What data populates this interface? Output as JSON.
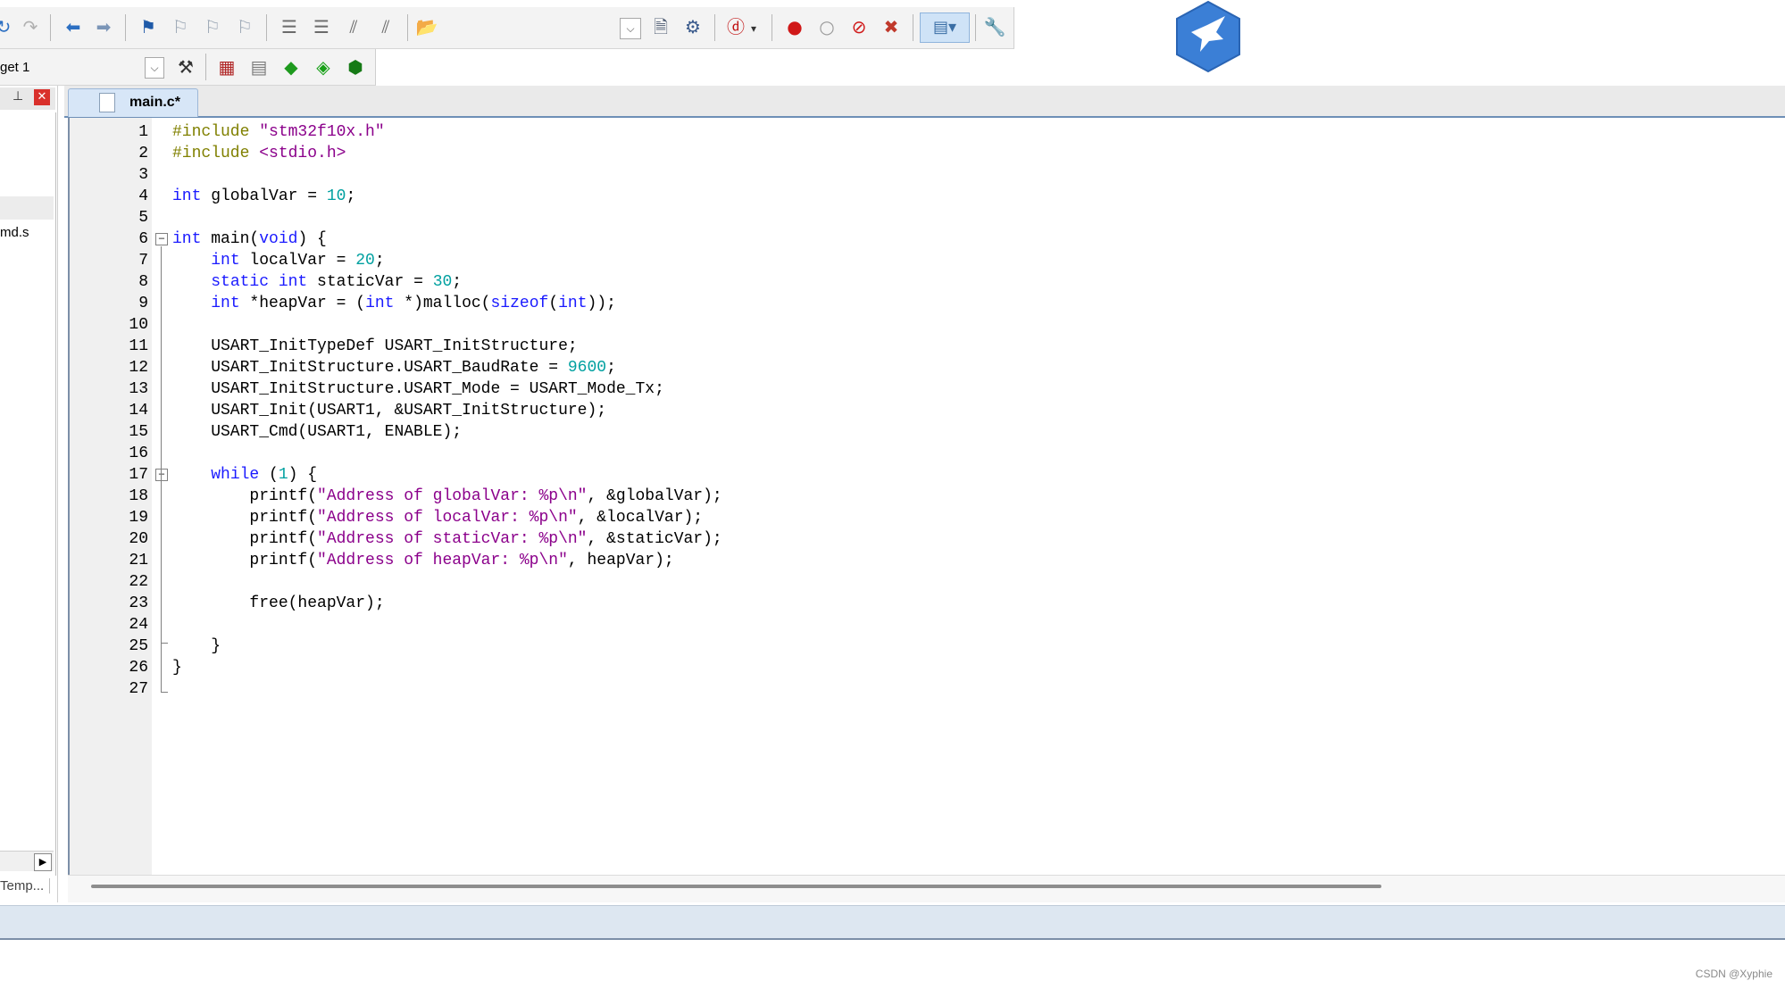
{
  "project": {
    "target_label": "get 1",
    "items": [
      "md.s"
    ],
    "bottom_tab": "Temp..."
  },
  "editor": {
    "tab_label": "main.c*"
  },
  "code_lines": [
    {
      "n": "1",
      "tokens": [
        {
          "t": "#include ",
          "c": "pp"
        },
        {
          "t": "\"stm32f10x.h\"",
          "c": "str"
        }
      ]
    },
    {
      "n": "2",
      "tokens": [
        {
          "t": "#include ",
          "c": "pp"
        },
        {
          "t": "<stdio.h>",
          "c": "str"
        }
      ]
    },
    {
      "n": "3",
      "tokens": []
    },
    {
      "n": "4",
      "tokens": [
        {
          "t": "int",
          "c": "kw"
        },
        {
          "t": " globalVar = ",
          "c": ""
        },
        {
          "t": "10",
          "c": "num"
        },
        {
          "t": ";",
          "c": ""
        }
      ]
    },
    {
      "n": "5",
      "tokens": []
    },
    {
      "n": "6",
      "tokens": [
        {
          "t": "int",
          "c": "kw"
        },
        {
          "t": " main(",
          "c": ""
        },
        {
          "t": "void",
          "c": "kw"
        },
        {
          "t": ") {",
          "c": ""
        }
      ]
    },
    {
      "n": "7",
      "tokens": [
        {
          "t": "    ",
          "c": ""
        },
        {
          "t": "int",
          "c": "kw"
        },
        {
          "t": " localVar = ",
          "c": ""
        },
        {
          "t": "20",
          "c": "num"
        },
        {
          "t": ";",
          "c": ""
        }
      ]
    },
    {
      "n": "8",
      "tokens": [
        {
          "t": "    ",
          "c": ""
        },
        {
          "t": "static int",
          "c": "kw"
        },
        {
          "t": " staticVar = ",
          "c": ""
        },
        {
          "t": "30",
          "c": "num"
        },
        {
          "t": ";",
          "c": ""
        }
      ]
    },
    {
      "n": "9",
      "tokens": [
        {
          "t": "    ",
          "c": ""
        },
        {
          "t": "int",
          "c": "kw"
        },
        {
          "t": " *heapVar = (",
          "c": ""
        },
        {
          "t": "int",
          "c": "kw"
        },
        {
          "t": " *)malloc(",
          "c": ""
        },
        {
          "t": "sizeof",
          "c": "kw"
        },
        {
          "t": "(",
          "c": ""
        },
        {
          "t": "int",
          "c": "kw"
        },
        {
          "t": "));",
          "c": ""
        }
      ]
    },
    {
      "n": "10",
      "tokens": []
    },
    {
      "n": "11",
      "tokens": [
        {
          "t": "    USART_InitTypeDef USART_InitStructure;",
          "c": ""
        }
      ]
    },
    {
      "n": "12",
      "tokens": [
        {
          "t": "    USART_InitStructure.USART_BaudRate = ",
          "c": ""
        },
        {
          "t": "9600",
          "c": "num"
        },
        {
          "t": ";",
          "c": ""
        }
      ]
    },
    {
      "n": "13",
      "tokens": [
        {
          "t": "    USART_InitStructure.USART_Mode = USART_Mode_Tx;",
          "c": ""
        }
      ]
    },
    {
      "n": "14",
      "tokens": [
        {
          "t": "    USART_Init(USART1, &USART_InitStructure);",
          "c": ""
        }
      ]
    },
    {
      "n": "15",
      "tokens": [
        {
          "t": "    USART_Cmd(USART1, ENABLE);",
          "c": ""
        }
      ]
    },
    {
      "n": "16",
      "tokens": []
    },
    {
      "n": "17",
      "tokens": [
        {
          "t": "    ",
          "c": ""
        },
        {
          "t": "while",
          "c": "kw"
        },
        {
          "t": " (",
          "c": ""
        },
        {
          "t": "1",
          "c": "num"
        },
        {
          "t": ") {",
          "c": ""
        }
      ]
    },
    {
      "n": "18",
      "tokens": [
        {
          "t": "        printf(",
          "c": ""
        },
        {
          "t": "\"Address of globalVar: %p\\n\"",
          "c": "str"
        },
        {
          "t": ", &globalVar);",
          "c": ""
        }
      ]
    },
    {
      "n": "19",
      "tokens": [
        {
          "t": "        printf(",
          "c": ""
        },
        {
          "t": "\"Address of localVar: %p\\n\"",
          "c": "str"
        },
        {
          "t": ", &localVar);",
          "c": ""
        }
      ]
    },
    {
      "n": "20",
      "tokens": [
        {
          "t": "        printf(",
          "c": ""
        },
        {
          "t": "\"Address of staticVar: %p\\n\"",
          "c": "str"
        },
        {
          "t": ", &staticVar);",
          "c": ""
        }
      ]
    },
    {
      "n": "21",
      "tokens": [
        {
          "t": "        printf(",
          "c": ""
        },
        {
          "t": "\"Address of heapVar: %p\\n\"",
          "c": "str"
        },
        {
          "t": ", heapVar);",
          "c": ""
        }
      ]
    },
    {
      "n": "22",
      "tokens": []
    },
    {
      "n": "23",
      "tokens": [
        {
          "t": "        free(heapVar);",
          "c": ""
        }
      ]
    },
    {
      "n": "24",
      "tokens": []
    },
    {
      "n": "25",
      "tokens": [
        {
          "t": "    }",
          "c": ""
        }
      ]
    },
    {
      "n": "26",
      "tokens": [
        {
          "t": "}",
          "c": ""
        }
      ]
    },
    {
      "n": "27",
      "tokens": []
    }
  ],
  "icons": {
    "toolbar1": [
      "redo-icon",
      "redo-disabled-icon",
      "nav-back-icon",
      "nav-forward-icon",
      "bookmark-icon",
      "bookmark-prev-icon",
      "bookmark-next-icon",
      "bookmark-clear-icon",
      "indent-icon",
      "unindent-icon",
      "comment-icon",
      "uncomment-icon",
      "open-file-icon",
      "find-dropdown-icon",
      "find-in-files-icon",
      "incremental-find-icon",
      "debug-session-icon",
      "breakpoint-icon",
      "breakpoint-disable-icon",
      "breakpoint-disable-all-icon",
      "breakpoint-kill-all-icon",
      "window-layout-icon",
      "configure-icon"
    ],
    "toolbar2": [
      "target-dropdown-icon",
      "target-options-icon",
      "translate-icon",
      "build-icon",
      "rebuild-icon",
      "download-icon"
    ]
  },
  "watermark": "CSDN @Xyphie",
  "colors": {
    "keyword": "#1a1aff",
    "preprocessor": "#808000",
    "string": "#8b008b",
    "number": "#00a0a0",
    "tab_active": "#d7e6f7",
    "logo_blue": "#3b7fd6"
  }
}
